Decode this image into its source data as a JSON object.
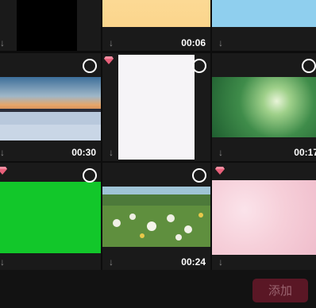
{
  "media": [
    {
      "download_icon": "download-icon",
      "duration": "",
      "selected": false,
      "premium": false,
      "thumb": "black"
    },
    {
      "download_icon": "download-icon",
      "duration": "00:06",
      "selected": false,
      "premium": false,
      "thumb": "peach"
    },
    {
      "download_icon": "download-icon",
      "duration": "",
      "selected": false,
      "premium": false,
      "thumb": "sky"
    },
    {
      "download_icon": "download-icon",
      "duration": "00:30",
      "selected": false,
      "premium": false,
      "thumb": "snow-sunset"
    },
    {
      "download_icon": "download-icon",
      "duration": "",
      "selected": false,
      "premium": true,
      "thumb": "white-paper"
    },
    {
      "download_icon": "download-icon",
      "duration": "00:17",
      "selected": false,
      "premium": false,
      "thumb": "green-canopy"
    },
    {
      "download_icon": "download-icon",
      "duration": "",
      "selected": false,
      "premium": true,
      "thumb": "green-screen"
    },
    {
      "download_icon": "download-icon",
      "duration": "00:24",
      "selected": false,
      "premium": false,
      "thumb": "dandelions"
    },
    {
      "download_icon": "download-icon",
      "duration": "",
      "selected": false,
      "premium": true,
      "thumb": "pink-watercolor"
    }
  ],
  "footer": {
    "add_label": "添加"
  },
  "colors": {
    "accent": "#5a1725",
    "accent_text": "#9a6470",
    "premium_gem": "#e8607a"
  }
}
